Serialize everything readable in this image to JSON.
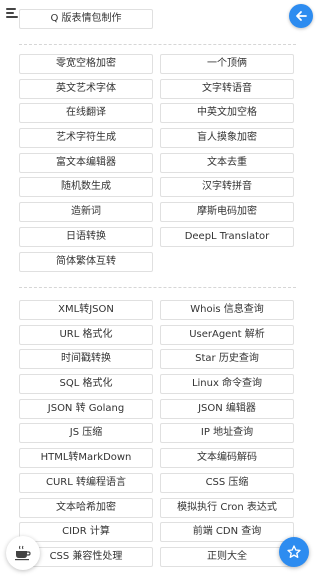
{
  "header": {
    "menu_icon": "menu-icon",
    "back_icon": "arrow-left-icon"
  },
  "top_partial": {
    "label": "Q 版表情包制作"
  },
  "group1": [
    "零宽空格加密",
    "一个顶俩",
    "英文艺术字体",
    "文字转语音",
    "在线翻译",
    "中英文加空格",
    "艺术字符生成",
    "盲人摸象加密",
    "富文本编辑器",
    "文本去重",
    "随机数生成",
    "汉字转拼音",
    "造新词",
    "摩斯电码加密",
    "日语转换",
    "DeepL Translator",
    "简体繁体互转"
  ],
  "group2": [
    "XML转JSON",
    "Whois 信息查询",
    "URL 格式化",
    "UserAgent 解析",
    "时间戳转换",
    "Star 历史查询",
    "SQL 格式化",
    "Linux 命令查询",
    "JSON 转 Golang",
    "JSON 编辑器",
    "JS 压缩",
    "IP 地址查询",
    "HTML转MarkDown",
    "文本编码解码",
    "CURL 转编程语言",
    "CSS 压缩",
    "文本哈希加密",
    "模拟执行 Cron 表达式",
    "CIDR 计算",
    "前端 CDN 查询",
    "CSS 兼容性处理",
    "正则大全"
  ],
  "fabs": {
    "coffee_icon": "coffee-cup-icon",
    "star_icon": "star-icon"
  },
  "colors": {
    "accent": "#2d8cf0",
    "border": "#e0e0e0",
    "text": "#333333"
  }
}
